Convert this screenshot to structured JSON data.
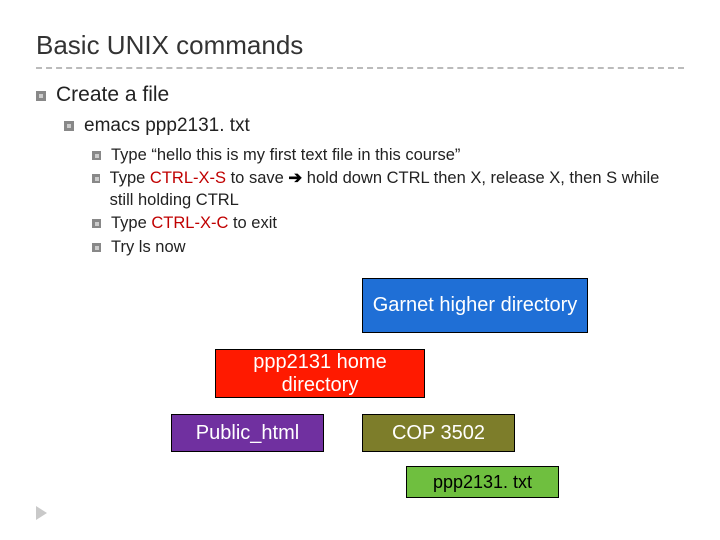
{
  "title": "Basic UNIX commands",
  "l1": "Create a file",
  "l2": "emacs ppp2131. txt",
  "l3": {
    "a": "Type “hello this is my first text file in this course”",
    "b_pre": "Type ",
    "b_hot": "CTRL-X-S",
    "b_mid": " to save ",
    "b_arrow": "➔",
    "b_post": " hold down CTRL then X, release X, then S while still holding CTRL",
    "c_pre": "Type ",
    "c_hot": "CTRL-X-C",
    "c_post": " to exit",
    "d": "Try ls now"
  },
  "boxes": {
    "blue": "Garnet higher directory",
    "red": "ppp2131 home directory",
    "purple": "Public_html",
    "olive": "COP 3502",
    "green": "ppp2131. txt"
  }
}
